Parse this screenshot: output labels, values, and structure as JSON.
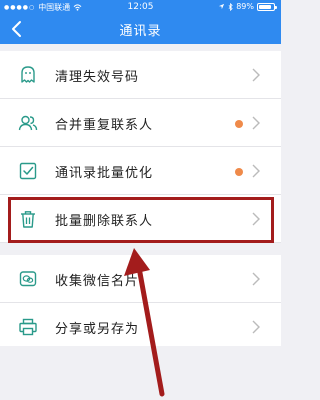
{
  "status_bar": {
    "carrier": "中国联通",
    "time": "12:05",
    "battery": "89%",
    "battery_level": 0.89
  },
  "navbar": {
    "title": "通讯录",
    "back_icon": "chevron-left-icon"
  },
  "menu": [
    {
      "label": "清理失效号码",
      "icon": "ghost-icon",
      "badge": false
    },
    {
      "label": "合并重复联系人",
      "icon": "contacts-icon",
      "badge": true
    },
    {
      "label": "通讯录批量优化",
      "icon": "checklist-icon",
      "badge": true
    },
    {
      "label": "批量删除联系人",
      "icon": "trash-icon",
      "badge": false
    },
    {
      "label": "收集微信名片",
      "icon": "wechat-icon",
      "badge": false
    },
    {
      "label": "分享或另存为",
      "icon": "printer-icon",
      "badge": false
    }
  ],
  "colors": {
    "header": "#2f8af0",
    "badge": "#ef8a4a",
    "annotation": "#a31c1c",
    "icon": "#2a9a8a"
  }
}
